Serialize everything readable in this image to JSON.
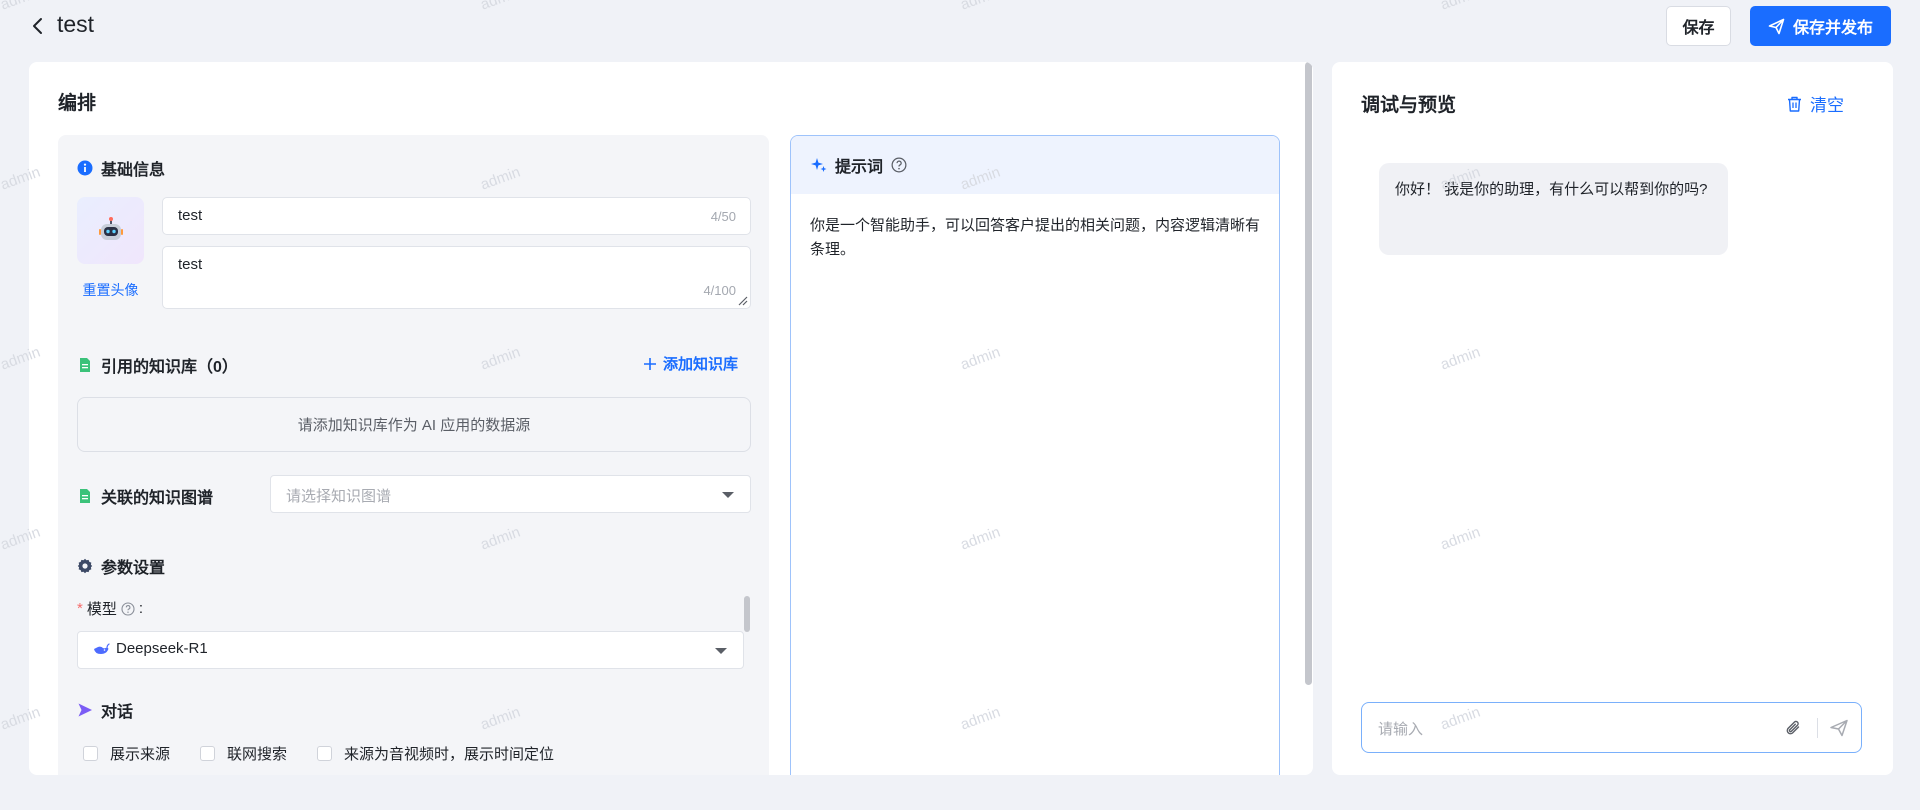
{
  "header": {
    "title": "test",
    "save_label": "保存",
    "publish_label": "保存并发布"
  },
  "editor": {
    "title": "编排",
    "basic_info": {
      "heading": "基础信息",
      "reset_avatar": "重置头像",
      "name": {
        "value": "test",
        "counter": "4/50"
      },
      "description": {
        "value": "test",
        "counter": "4/100"
      }
    },
    "knowledge": {
      "heading": "引用的知识库（0）",
      "add_label": "添加知识库",
      "empty_text": "请添加知识库作为 AI 应用的数据源"
    },
    "graph": {
      "heading": "关联的知识图谱",
      "placeholder": "请选择知识图谱"
    },
    "params": {
      "heading": "参数设置",
      "model_label": "模型",
      "model_colon": ":",
      "model_value": "Deepseek-R1"
    },
    "dialogue": {
      "heading": "对话",
      "options": [
        {
          "label": "展示来源",
          "checked": false
        },
        {
          "label": "联网搜索",
          "checked": false
        },
        {
          "label": "来源为音视频时，展示时间定位",
          "checked": false
        }
      ]
    },
    "prompt": {
      "heading": "提示词",
      "text": "你是一个智能助手，可以回答客户提出的相关问题，内容逻辑清晰有条理。"
    }
  },
  "preview": {
    "title": "调试与预览",
    "clear_label": "清空",
    "greeting": "你好！ 我是你的助理，有什么可以帮到你的吗?",
    "input_placeholder": "请输入"
  },
  "watermark": "admin",
  "colors": {
    "accent": "#1a6dff",
    "page_bg": "#f0f2f7",
    "card_bg": "#f4f5f8",
    "required": "#f56c6c"
  }
}
